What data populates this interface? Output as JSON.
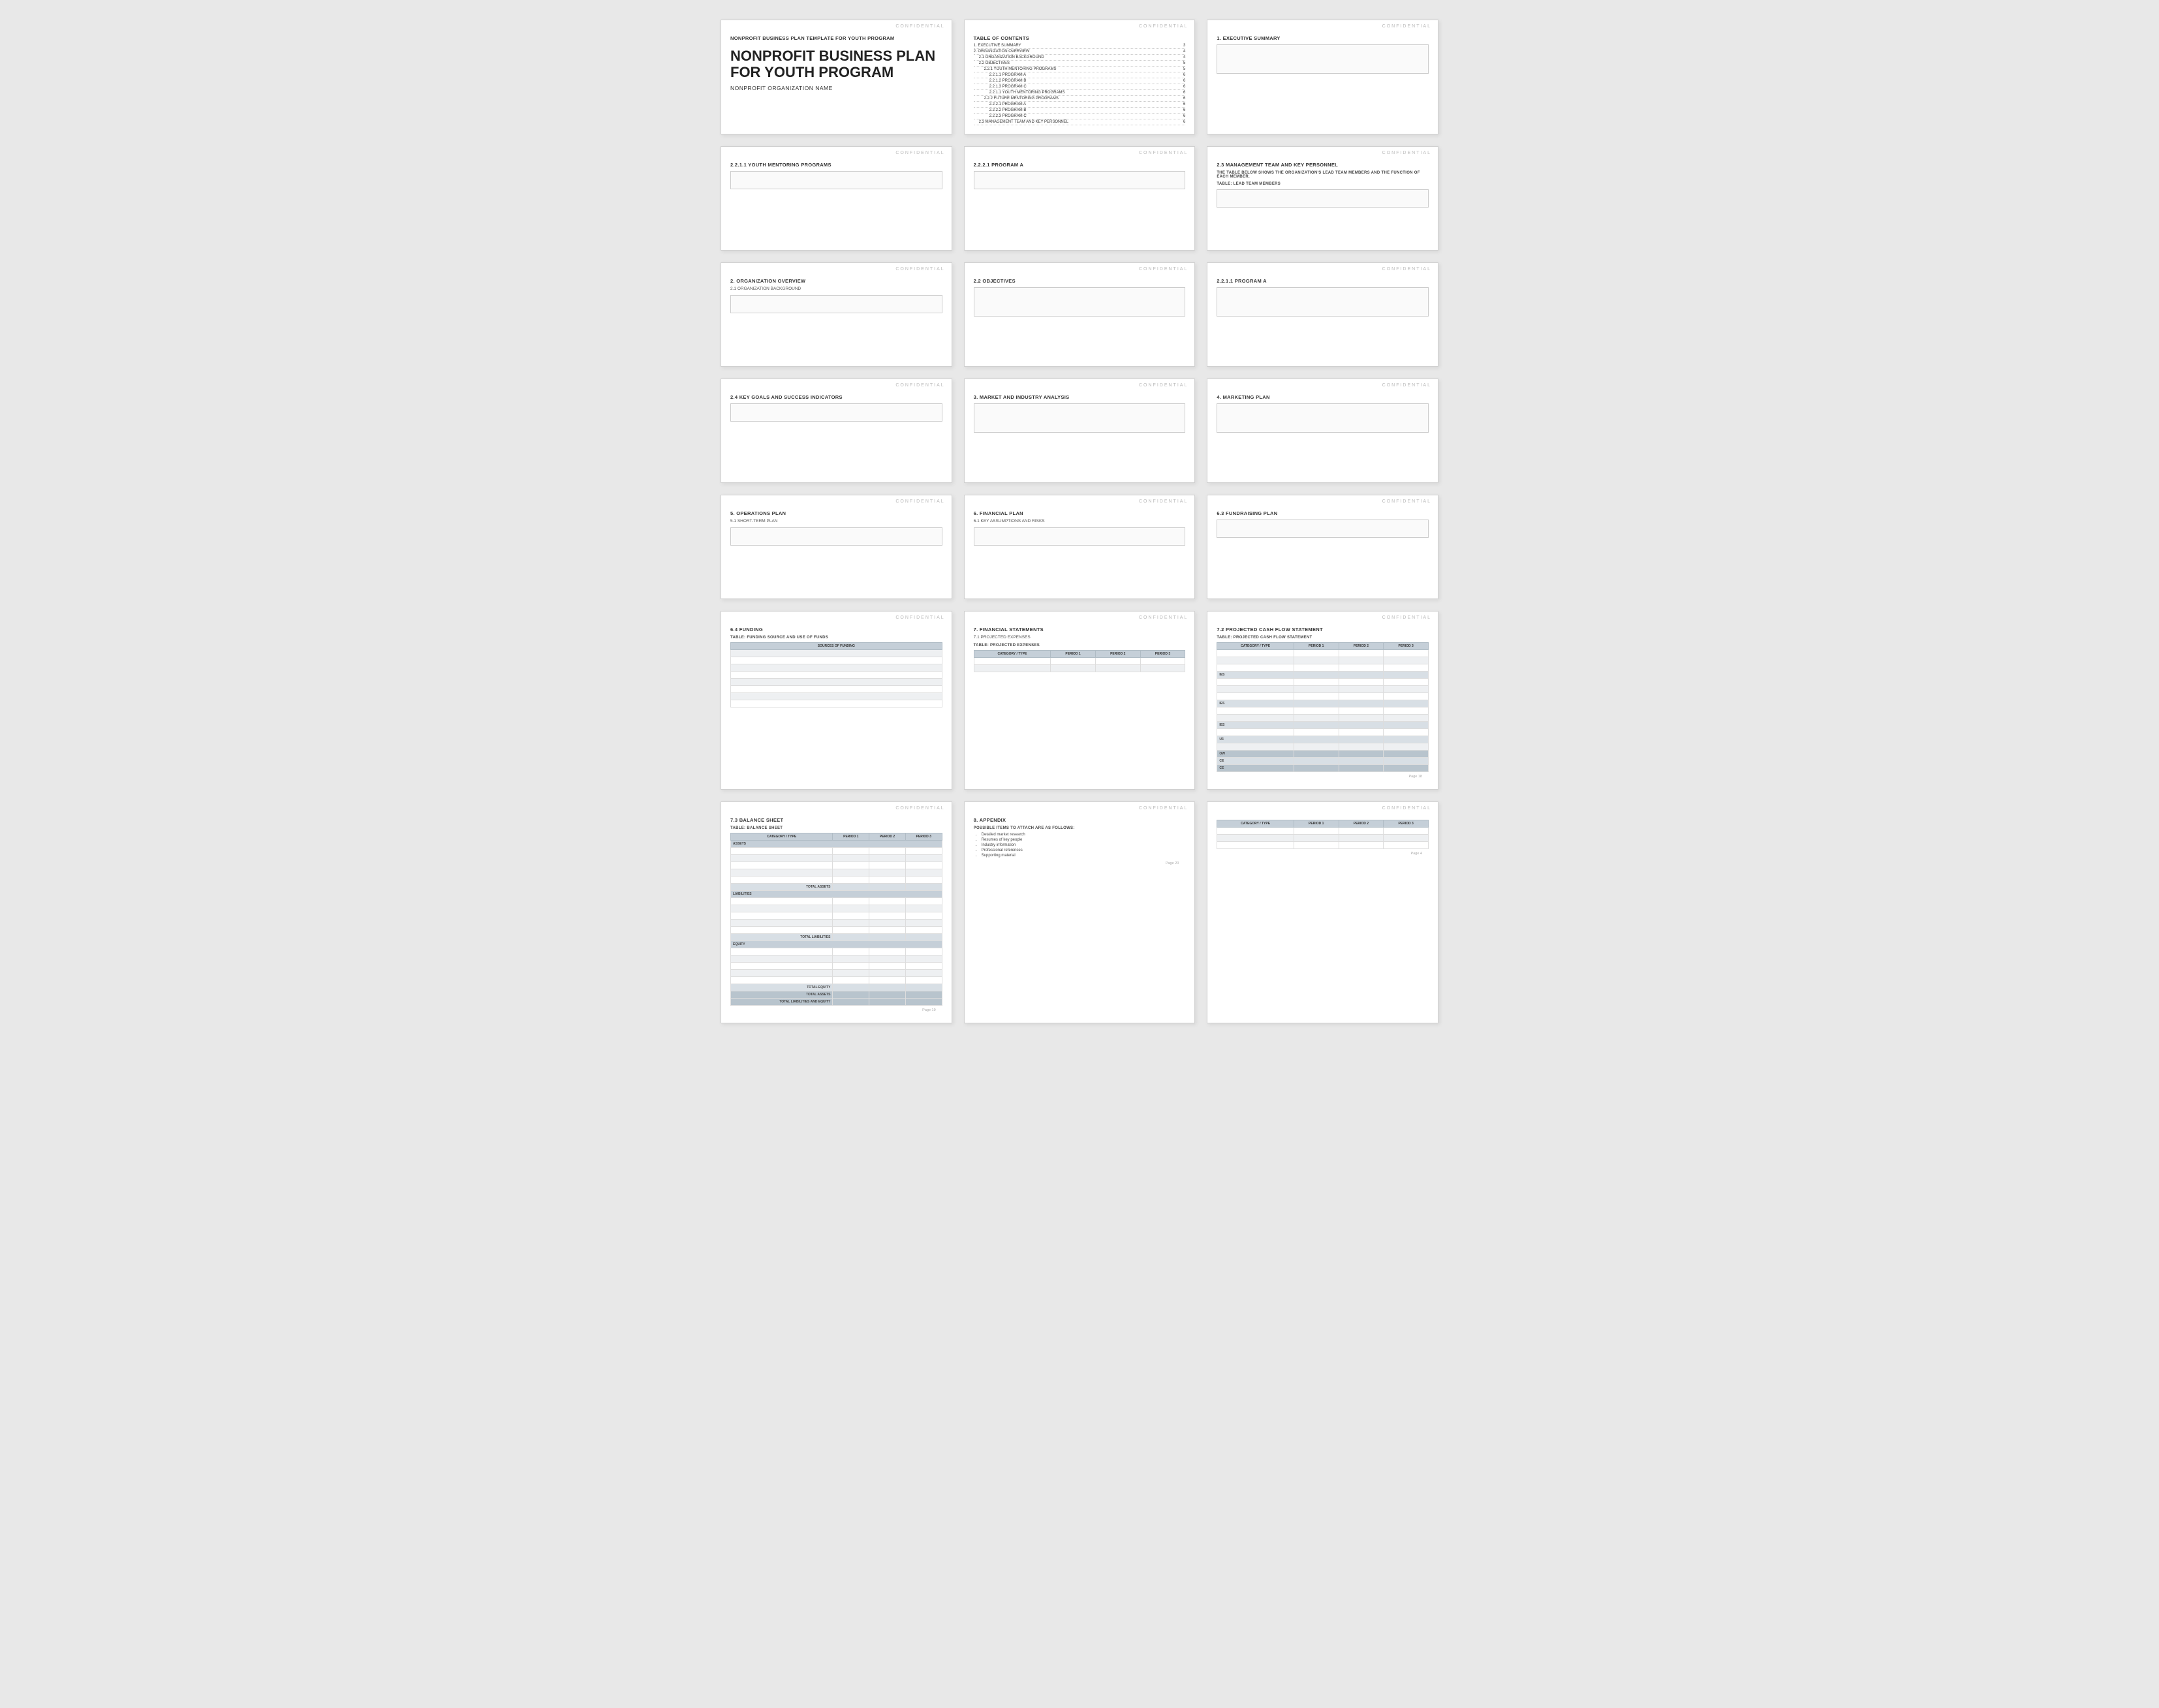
{
  "confidential": "CONFIDENTIAL",
  "pages": {
    "cover": {
      "subtitle": "NONPROFIT BUSINESS PLAN TEMPLATE FOR YOUTH PROGRAM",
      "title": "NONPROFIT BUSINESS PLAN FOR YOUTH PROGRAM",
      "org_name": "NONPROFIT ORGANIZATION NAME"
    },
    "toc": {
      "heading": "TABLE OF CONTENTS",
      "items": [
        {
          "label": "1.   EXECUTIVE SUMMARY",
          "page": "3",
          "indent": 0
        },
        {
          "label": "2.   ORGANIZATION OVERVIEW",
          "page": "4",
          "indent": 0
        },
        {
          "label": "2.1  ORGANIZATION BACKGROUND",
          "page": "4",
          "indent": 1
        },
        {
          "label": "2.2  OBJECTIVES",
          "page": "5",
          "indent": 1
        },
        {
          "label": "2.2.1  YOUTH MENTORING PROGRAMS",
          "page": "5",
          "indent": 2
        },
        {
          "label": "2.2.1.1  PROGRAM A",
          "page": "6",
          "indent": 3
        },
        {
          "label": "2.2.1.2  PROGRAM B",
          "page": "6",
          "indent": 3
        },
        {
          "label": "2.2.1.3  PROGRAM C",
          "page": "6",
          "indent": 3
        },
        {
          "label": "2.2.1.1  YOUTH MENTORING PROGRAMS",
          "page": "6",
          "indent": 3
        },
        {
          "label": "2.2.2  FUTURE MENTORING PROGRAMS",
          "page": "6",
          "indent": 2
        },
        {
          "label": "2.2.2.1  PROGRAM A",
          "page": "6",
          "indent": 3
        },
        {
          "label": "2.2.2.2  PROGRAM B",
          "page": "6",
          "indent": 3
        },
        {
          "label": "2.2.2.3  PROGRAM C",
          "page": "6",
          "indent": 3
        },
        {
          "label": "2.3  MANAGEMENT TEAM AND KEY PERSONNEL",
          "page": "6",
          "indent": 1
        }
      ]
    },
    "exec_summary": {
      "heading": "1. EXECUTIVE SUMMARY"
    },
    "youth_mentoring": {
      "heading": "2.2.1.1  YOUTH MENTORING PROGRAMS"
    },
    "program_a_1": {
      "heading": "2.2.2.1  PROGRAM A"
    },
    "mgmt_team": {
      "heading": "2.3  MANAGEMENT TEAM AND KEY PERSONNEL",
      "desc": "The table below shows the organization's lead team members and the function of each member.",
      "table_label": "TABLE:  LEAD TEAM MEMBERS"
    },
    "org_overview": {
      "heading": "2. ORGANIZATION OVERVIEW",
      "subheading": "2.1  ORGANIZATION BACKGROUND"
    },
    "objectives": {
      "heading": "2.2  OBJECTIVES"
    },
    "program_a_2": {
      "heading": "2.2.1.1  PROGRAM A"
    },
    "key_goals": {
      "heading": "2.4  KEY GOALS AND SUCCESS INDICATORS"
    },
    "market_analysis": {
      "heading": "3. MARKET AND INDUSTRY ANALYSIS"
    },
    "marketing_plan": {
      "heading": "4. MARKETING PLAN"
    },
    "operations_plan": {
      "heading": "5. OPERATIONS PLAN",
      "subheading": "5.1  SHORT-TERM PLAN"
    },
    "financial_plan": {
      "heading": "6. FINANCIAL PLAN",
      "subheading": "6.1  KEY ASSUMPTIONS AND RISKS"
    },
    "fundraising_plan": {
      "heading": "6.3  FUNDRAISING PLAN"
    },
    "funding": {
      "heading": "6.4  FUNDING",
      "table_label": "TABLE:  FUNDING SOURCE AND USE OF FUNDS",
      "col_label": "SOURCES OF FUNDING"
    },
    "financial_statements": {
      "heading": "7. FINANCIAL STATEMENTS",
      "subheading": "7.1  PROJECTED EXPENSES",
      "table_label": "TABLE:  PROJECTED EXPENSES"
    },
    "cash_flow": {
      "heading": "7.2  PROJECTED CASH FLOW STATEMENT",
      "table_label": "TABLE:  PROJECTED CASH FLOW STATEMENT",
      "col_category": "CATEGORY / TYPE",
      "col_period1": "PERIOD 1",
      "col_period2": "PERIOD 2",
      "col_period3": "PERIOD 3"
    },
    "balance_sheet": {
      "heading": "7.3  BALANCE SHEET",
      "table_label": "TABLE:  BALANCE SHEET",
      "col_category": "CATEGORY / TYPE",
      "col_period1": "PERIOD 1",
      "col_period2": "PERIOD 2",
      "col_period3": "PERIOD 3",
      "section_assets": "ASSETS",
      "total_assets": "TOTAL ASSETS",
      "section_liabilities": "LIABILITIES",
      "total_liabilities": "TOTAL LIABILITIES",
      "section_equity": "EQUITY",
      "total_equity": "TOTAL EQUITY",
      "total_assets2": "TOTAL ASSETS",
      "total_liabilities_equity": "TOTAL LIABILITIES AND EQUITY",
      "page_num": "Page 19"
    },
    "appendix": {
      "heading": "8. APPENDIX",
      "desc": "Possible items to attach are as follows:",
      "items": [
        "Detailed market research",
        "Resumes of key people",
        "Industry information",
        "Professional references",
        "Supporting material"
      ],
      "page_num": "Page 20"
    },
    "cash_flow_right": {
      "page_num": "Page 4",
      "page_num2": "Page 18"
    }
  }
}
